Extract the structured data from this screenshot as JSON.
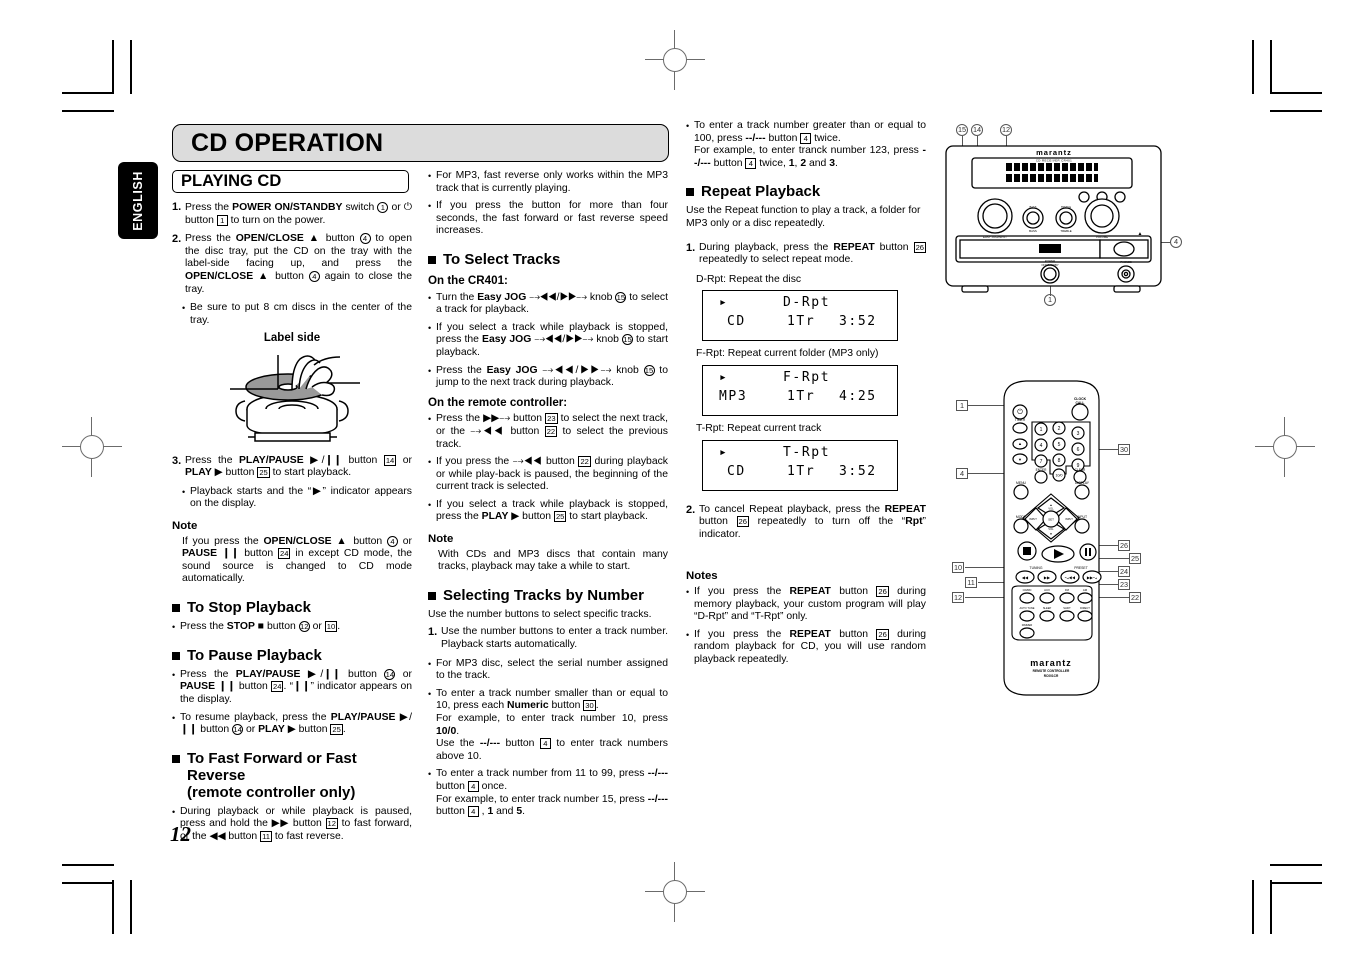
{
  "page": {
    "number": "12",
    "language_tab": "ENGLISH",
    "chapter_title": "CD OPERATION"
  },
  "section_playing_cd": {
    "heading": "PLAYING CD",
    "steps": [
      {
        "num": "1.",
        "html": "Press the <b>POWER ON/STANDBY</b> switch <span class='cnum'>1</span> or <span style='font-family:\"DejaVu Sans\",sans-serif'>&#9211;</span> button <span class='bnum'>1</span> to turn on the power."
      },
      {
        "num": "2.",
        "html": "Press the <b>OPEN/CLOSE</b> &#9650; button <span class='cnum'>4</span> to open the disc tray, put the CD on the tray with the label-side facing up, and press the <b>OPEN/CLOSE</b> &#9650; button <span class='cnum'>4</span> again to close the tray."
      }
    ],
    "step2_bullet": "Be sure to put 8 cm discs in the center of the tray.",
    "illustration_caption": "Label side",
    "step3": {
      "num": "3.",
      "html": "Press the <b>PLAY/PAUSE</b> &#9654;/&#10073;&#10073; button <span class='bnum'>14</span> or <b>PLAY</b> &#9654; button <span class='bnum'>25</span> to start playback."
    },
    "step3_bullet": "Playback starts and the “&#9654;” indicator appears on the display.",
    "note_heading": "Note",
    "note_html": "If you press the <b>OPEN/CLOSE</b> &#9650; button <span class='cnum'>4</span> or <b>PAUSE</b> &#10073;&#10073; button <span class='bnum'>24</span> in except CD mode, the sound source is changed to CD mode automatically."
  },
  "section_stop": {
    "heading": "To Stop Playback",
    "bullet_html": "Press the <b>STOP</b> &#9632; button <span class='cnum'>12</span> or <span class='bnum'>10</span>."
  },
  "section_pause": {
    "heading": "To Pause Playback",
    "bullets_html": [
      "Press the <b>PLAY/PAUSE</b> &#9654;/&#10073;&#10073; button <span class='cnum'>14</span> or <b>PAUSE</b> &#10073;&#10073; button <span class='bnum'>24</span>. “&#10073;&#10073;” indicator appears on the display.",
      "To resume playback, press the <b>PLAY/PAUSE</b> &#9654;/&#10073;&#10073; button <span class='cnum'>14</span> or <b>PLAY</b> &#9654; button <span class='bnum'>25</span>."
    ]
  },
  "section_ff_rev": {
    "heading_line1": "To Fast Forward or Fast Reverse",
    "heading_line2": "(remote controller only)",
    "bullets_html": [
      "During playback or while playback is paused, press and hold the &#9654;&#9654; button <span class='bnum'>12</span> to fast forward, or the &#9664;&#9664; button <span class='bnum'>11</span> to fast reverse."
    ]
  },
  "column2_top_bullets": [
    "For MP3, fast reverse only works within the MP3 track that is currently playing.",
    "If you press the button for more than four seconds, the fast forward or fast reverse speed increases."
  ],
  "section_select_tracks": {
    "heading": "To Select Tracks",
    "sub1": "On the CR401:",
    "cr401_bullets_html": [
      "Turn the <b>Easy JOG</b> &#10509;&#9664;&#9664;/&#9654;&#9654;&#10509; knob <span class='cnum'>15</span> to select a track for playback.",
      "If you select a track while playback is stopped, press the <b>Easy JOG</b> &#10509;&#9664;&#9664;/&#9654;&#9654;&#10509; knob <span class='cnum'>15</span> to start playback.",
      "Press the <b>Easy JOG</b> &#10509;&#9664;&#9664;/&#9654;&#9654;&#10509; knob <span class='cnum'>15</span> to jump to the next track during playback."
    ],
    "sub2": "On the remote controller:",
    "remote_bullets_html": [
      "Press the &#9654;&#9654;&#10509; button <span class='bnum'>23</span> to select the next track, or the &#10509;&#9664;&#9664; button <span class='bnum'>22</span> to select the previous track.",
      "If you press the &#10509;&#9664;&#9664; button <span class='bnum'>22</span> during playback or while play-back is paused, the beginning of the current track is selected.",
      "If you select a track while playback is stopped, press the <b>PLAY</b> &#9654; button <span class='bnum'>25</span> to start playback."
    ],
    "note_heading": "Note",
    "note_text": "With CDs and MP3 discs that contain many tracks, playback may take a while to start."
  },
  "section_select_by_number": {
    "heading": "Selecting Tracks by Number",
    "intro": "Use the number buttons to select specific tracks.",
    "step1": {
      "num": "1.",
      "text": "Use the number buttons to enter a track number.  Playback starts automatically."
    },
    "bullets_html": [
      "For MP3 disc, select the serial number assigned to the track.",
      "To enter a track number smaller than or equal to 10, press each <b>Numeric</b> button <span class='bnum'>30</span>.<br>For example, to enter track number 10, press <b>10/0</b>.<br>Use the <b>--/---</b> button <span class='bnum'>4</span> to enter track numbers above 10.",
      "To enter a track number from 11 to 99, press <b>--/---</b> button <span class='bnum'>4</span> once.<br>For example, to enter track number 15, press <b>--/---</b> button <span class='bnum'>4</span> , <b>1</b> and <b>5</b>.",
      "To enter a track number greater than or equal to 100, press <b>--/---</b> button <span class='bnum'>4</span> twice.<br>For example, to enter tranck number 123, press <b>--/---</b> button <span class='bnum'>4</span> twice, <b>1</b>, <b>2</b> and <b>3</b>."
    ]
  },
  "section_repeat": {
    "heading": "Repeat Playback",
    "intro": "Use the Repeat function to play a track, a folder for MP3 only or a disc repeatedly.",
    "step1": {
      "num": "1.",
      "html": "During playback, press the <b>REPEAT</b> button <span class='bnum'>26</span> repeatedly to select repeat mode."
    },
    "modes": [
      {
        "label": "D-Rpt: Repeat the disc",
        "display": {
          "play_icon": "▸",
          "mode": "D-Rpt",
          "source": "CD",
          "track": "1Tr",
          "time": "3:52"
        }
      },
      {
        "label": "F-Rpt: Repeat current folder (MP3 only)",
        "display": {
          "play_icon": "▸",
          "mode": "F-Rpt",
          "source": "MP3",
          "track": "1Tr",
          "time": "4:25"
        }
      },
      {
        "label": "T-Rpt: Repeat current track",
        "display": {
          "play_icon": "▸",
          "mode": "T-Rpt",
          "source": "CD",
          "track": "1Tr",
          "time": "3:52"
        }
      }
    ],
    "step2": {
      "num": "2.",
      "html": "To cancel Repeat playback, press the <b>REPEAT</b> button <span class='bnum'>26</span> repeatedly to turn off the “<b>Rpt</b>” indicator."
    },
    "notes_heading": "Notes",
    "notes_html": [
      "If you press the <b>REPEAT</b> button <span class='bnum'>26</span> during memory playback, your custom program will play “D-Rpt” and “T-Rpt” only.",
      "If you press the <b>REPEAT</b> button <span class='bnum'>26</span> during random playback for CD, you will use random playback repeatedly."
    ]
  },
  "unit_figure": {
    "brand": "marantz",
    "model_line": "CD RECEIVER CR401",
    "callouts": [
      "15",
      "14",
      "12",
      "4",
      "1"
    ],
    "knob_labels": [
      "EASY JOG/INPUT",
      "BASS",
      "TREBLE",
      "VOLUME"
    ],
    "disc_logo": "COMPACT DISC DIGITAL AUDIO",
    "power_label": "POWER ON/STANDBY",
    "phones_label": "PHONES"
  },
  "remote_figure": {
    "brand": "marantz",
    "sub1": "REMOTE CONTROLLER",
    "sub2": "RC001CR",
    "callouts_left": [
      "1",
      "4",
      "10",
      "11",
      "12"
    ],
    "callouts_right": [
      "30",
      "26",
      "25",
      "24",
      "23",
      "22"
    ],
    "buttons": {
      "power": "⏻",
      "clock_call_l1": "CLOCK",
      "clock_call_l2": "CALL",
      "timer": "TIMER",
      "numerics": [
        "1",
        "2",
        "3",
        "4",
        "5",
        "6",
        "7",
        "8",
        "9",
        "10/0"
      ],
      "enter": "ENTER",
      "clear": "CLEAR",
      "menu": "MENU",
      "display": "DISPLAY",
      "mode": "MODE",
      "input": "INPUT",
      "vol_up": "VOL",
      "vol_down": "VOL",
      "dt_left": "INPUT",
      "dt_right": "INPUT",
      "center": "SET",
      "tuning": "TUNING",
      "preset": "PRESET",
      "bottom_row1": [
        "CD/RD",
        "AUX",
        "FM",
        "AM"
      ],
      "bottom_row2": [
        "AUTO TUNE",
        "SLEEP",
        "SHIFT",
        "DIRECT"
      ],
      "bottom_row3": [
        "DIMMER"
      ]
    }
  }
}
